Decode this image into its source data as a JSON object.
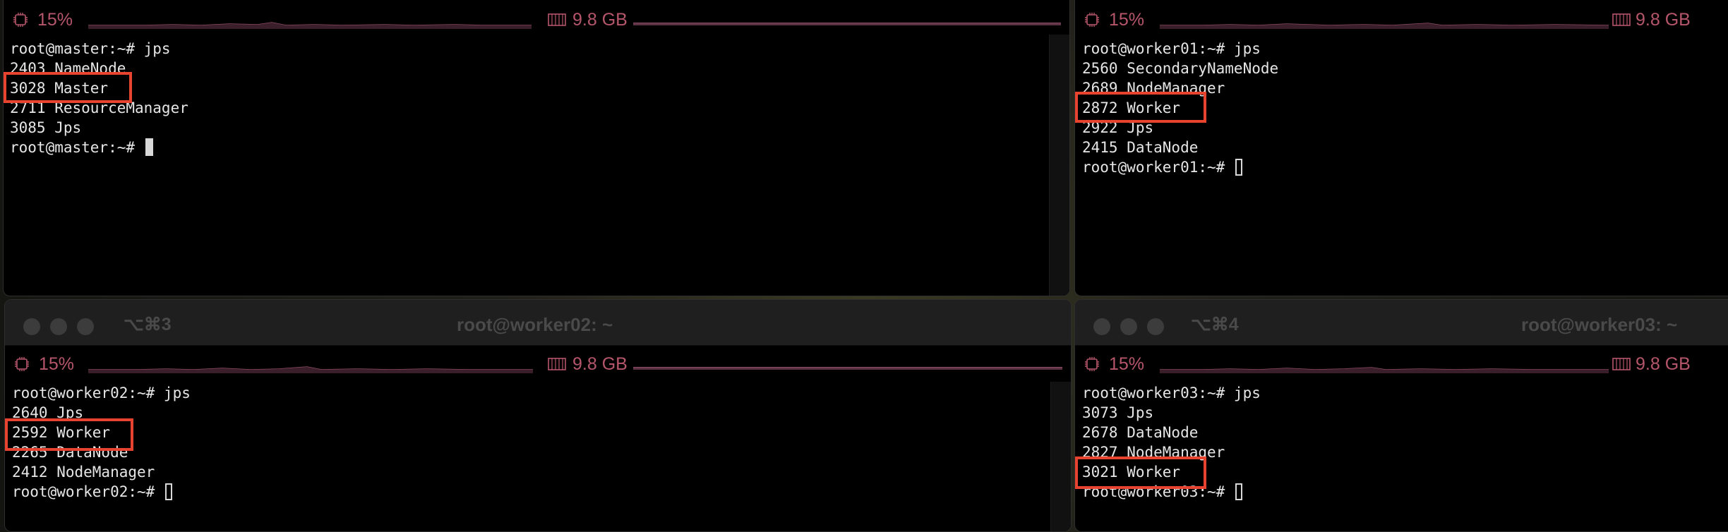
{
  "windows": {
    "master": {
      "cpu": "15%",
      "mem": "9.8 GB",
      "lines": [
        "root@master:~# jps",
        "2403 NameNode",
        "3028 Master",
        "2711 ResourceManager",
        "3085 Jps"
      ],
      "prompt": "root@master:~# "
    },
    "worker01": {
      "cpu": "15%",
      "mem": "9.8 GB",
      "lines": [
        "root@worker01:~# jps",
        "2560 SecondaryNameNode",
        "2689 NodeManager",
        "2872 Worker",
        "2922 Jps",
        "2415 DataNode"
      ],
      "prompt": "root@worker01:~# "
    },
    "worker02": {
      "title": "root@worker02: ~",
      "shortcut": "⌥⌘3",
      "cpu": "15%",
      "mem": "9.8 GB",
      "lines": [
        "root@worker02:~# jps",
        "2640 Jps",
        "2592 Worker",
        "2265 DataNode",
        "2412 NodeManager"
      ],
      "prompt": "root@worker02:~# "
    },
    "worker03": {
      "title": "root@worker03: ~",
      "shortcut": "⌥⌘4",
      "cpu": "15%",
      "mem": "9.8 GB",
      "lines": [
        "root@worker03:~# jps",
        "3073 Jps",
        "2678 DataNode",
        "2827 NodeManager",
        "3021 Worker"
      ],
      "prompt": "root@worker03:~# "
    }
  },
  "icons": {
    "cpu": "cpu-chip-icon",
    "memory": "memory-module-icon",
    "traffic_lights": "window-control-icons"
  },
  "colors": {
    "highlight": "#e8432e",
    "status_text": "#b5566b",
    "terminal_bg": "#000000",
    "terminal_fg": "#e6e6e6"
  }
}
